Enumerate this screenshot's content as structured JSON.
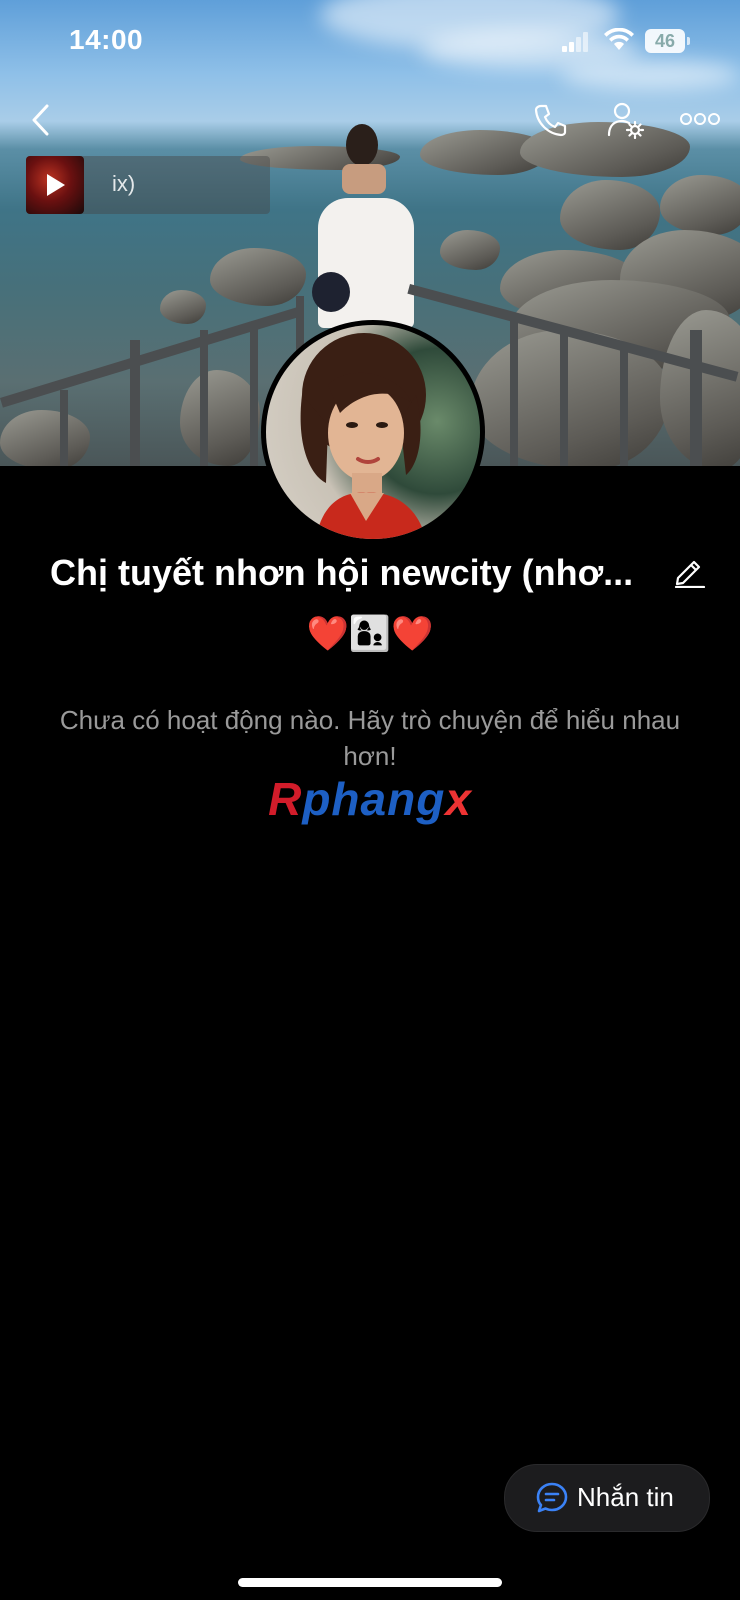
{
  "status_bar": {
    "time": "14:00",
    "battery": "46"
  },
  "header": {
    "back_icon": "chevron-left-icon",
    "call_icon": "phone-icon",
    "settings_icon": "user-settings-icon",
    "more_icon": "more-horizontal-icon"
  },
  "music": {
    "title": "ix)",
    "play_icon": "play-icon"
  },
  "profile": {
    "name": "Chị tuyết nhơn hội newcity (nhơ...",
    "bio": "❤️👩‍👦❤️",
    "empty_message": "Chưa có hoạt động nào. Hãy trò chuyện để hiểu nhau hơn!"
  },
  "watermark": {
    "first": "R",
    "middle": "phang",
    "last": "x"
  },
  "chat_button": {
    "label": "Nhắn tin",
    "icon": "chat-bubble-icon"
  },
  "colors": {
    "background": "#000000",
    "chat_accent": "#3b82f6",
    "secondary_text": "#9a9a9a"
  }
}
